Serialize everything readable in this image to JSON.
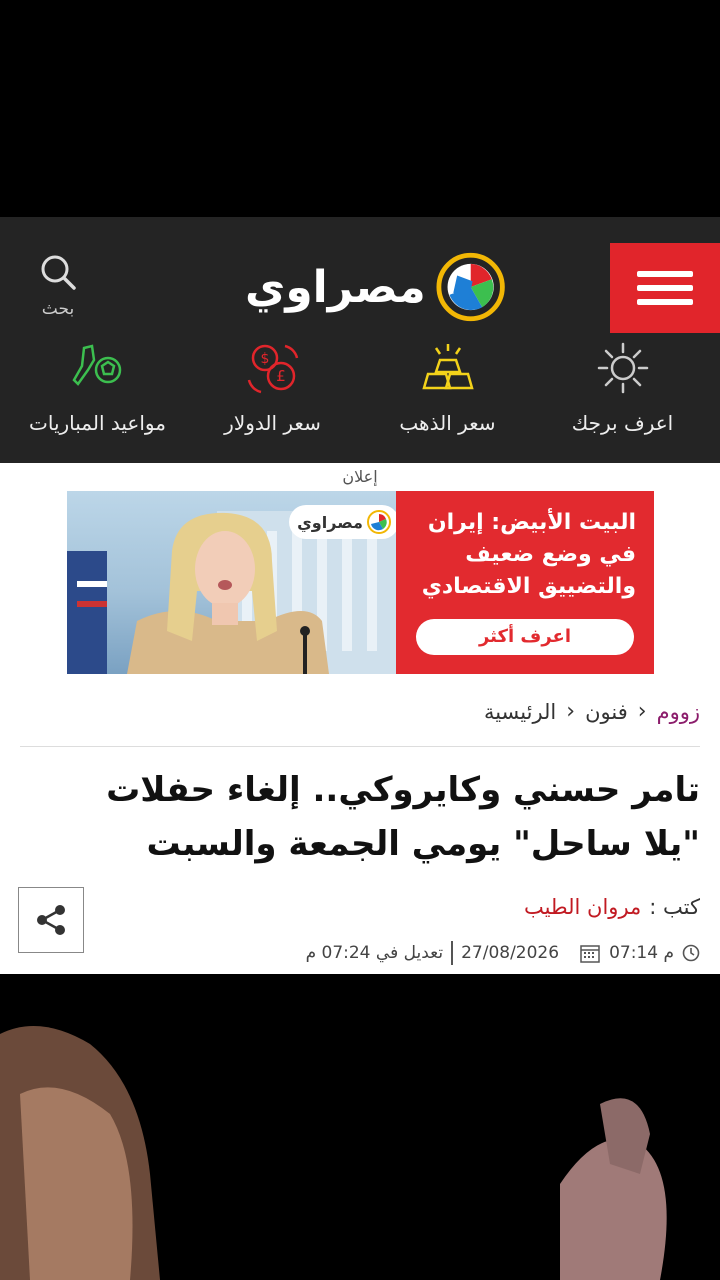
{
  "header": {
    "logo_text": "مصراوي",
    "search_label": "بحث",
    "quick_links": [
      {
        "label": "اعرف برجك",
        "icon": "sun-icon",
        "color": "#cccccc"
      },
      {
        "label": "سعر الذهب",
        "icon": "gold-bars-icon",
        "color": "#f3d21a"
      },
      {
        "label": "سعر الدولار",
        "icon": "currency-exchange-icon",
        "color": "#e1252b"
      },
      {
        "label": "مواعيد المباريات",
        "icon": "football-icon",
        "color": "#3cbf4f"
      }
    ],
    "accent": "#e1252b"
  },
  "ad": {
    "label": "إعلان",
    "headline": "البيت الأبيض: إيران في وضع ضعيف والتضييق الاقتصادي",
    "cta": "اعرف أكثر",
    "logo_text": "مصراوي"
  },
  "breadcrumb": {
    "home": "الرئيسية",
    "section": "فنون",
    "current": "زووم"
  },
  "article": {
    "title": "تامر حسني وكايروكي.. إلغاء حفلات \"يلا ساحل\" يومي الجمعة والسبت",
    "author_label": "كتب :",
    "author_name": "مروان الطيب",
    "time": "07:14 م",
    "date": "27/08/2026",
    "modified": "تعديل في 07:24 م"
  }
}
